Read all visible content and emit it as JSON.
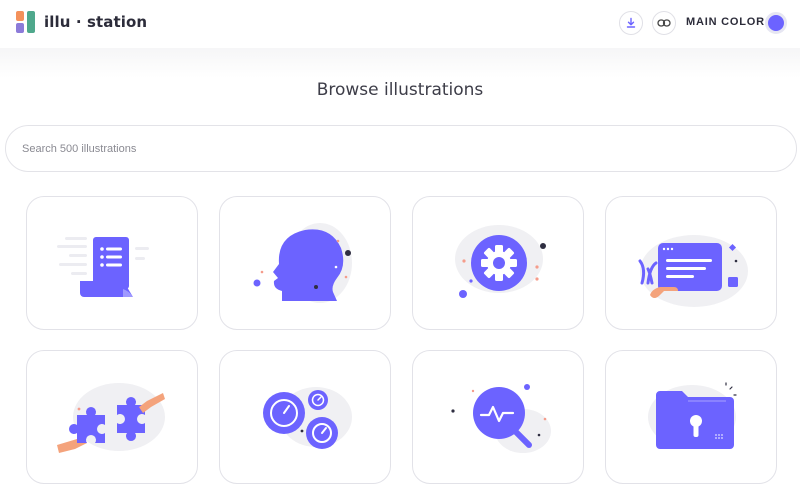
{
  "app": {
    "logo_text": "illu · station",
    "main_color_label": "MAIN COLOR",
    "main_color": "#6c63ff"
  },
  "header": {
    "download_icon": "download-icon",
    "link_icon": "link-icon"
  },
  "page": {
    "title": "Browse illustrations"
  },
  "search": {
    "placeholder": "Search 500 illustrations",
    "value": ""
  },
  "illustrations": [
    {
      "name": "document-list",
      "icon": "document-list-illustration"
    },
    {
      "name": "head-profile",
      "icon": "head-profile-illustration"
    },
    {
      "name": "settings-gear",
      "icon": "settings-gear-illustration"
    },
    {
      "name": "hand-holding-card",
      "icon": "hand-holding-card-illustration"
    },
    {
      "name": "puzzle-hands",
      "icon": "puzzle-hands-illustration"
    },
    {
      "name": "speed-gauges",
      "icon": "speed-gauges-illustration"
    },
    {
      "name": "activity-search",
      "icon": "activity-search-illustration"
    },
    {
      "name": "locked-folder",
      "icon": "locked-folder-illustration"
    }
  ],
  "colors": {
    "accent": "#6c63ff",
    "skin": "#f4a37c",
    "blob": "#f0f0f3",
    "dot_dark": "#2f2e41",
    "dot_pink": "#f59c8b"
  }
}
